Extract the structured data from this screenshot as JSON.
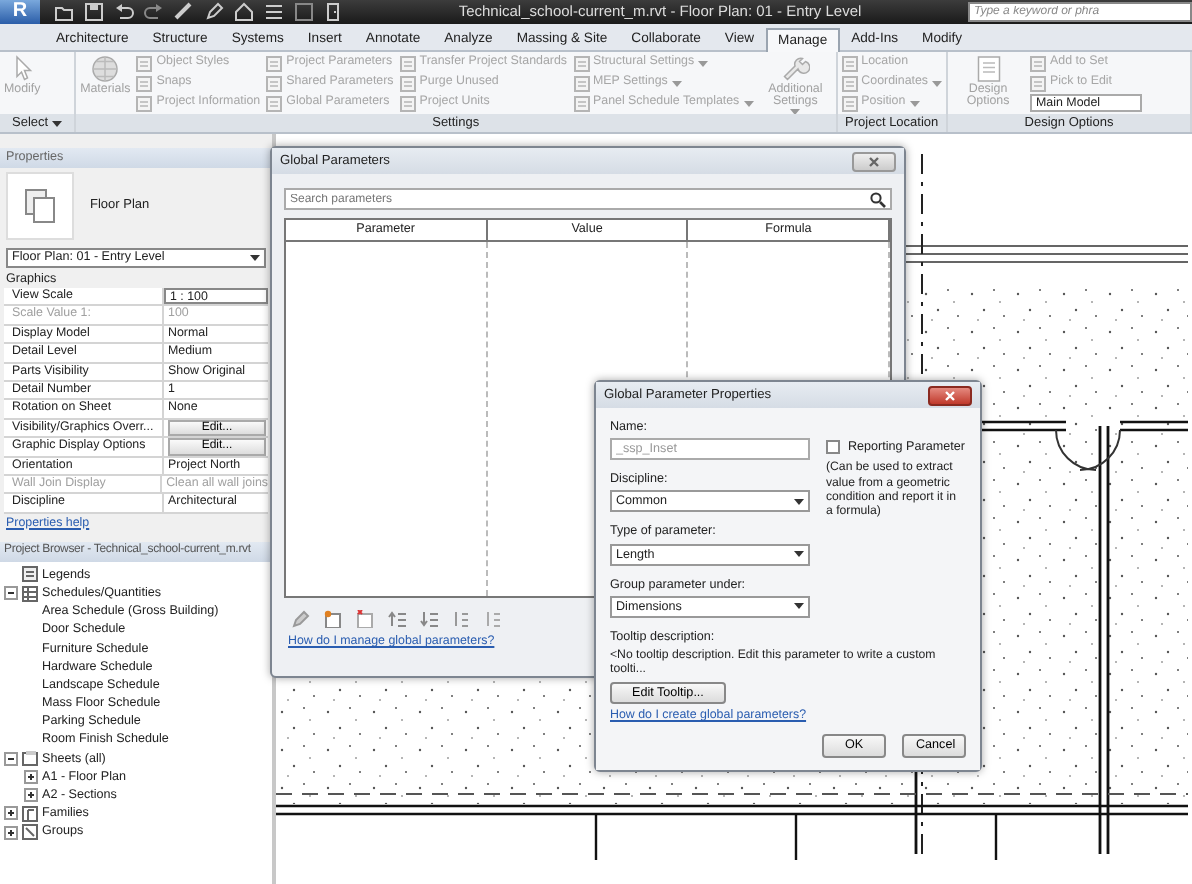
{
  "window": {
    "logo": "R",
    "title": "Technical_school-current_m.rvt - Floor Plan: 01 - Entry Level"
  },
  "help_search": {
    "placeholder": "Type a keyword or phra"
  },
  "ribbon_tabs": [
    {
      "label": "Architecture",
      "selected": false
    },
    {
      "label": "Structure",
      "selected": false
    },
    {
      "label": "Systems",
      "selected": false
    },
    {
      "label": "Insert",
      "selected": false
    },
    {
      "label": "Annotate",
      "selected": false
    },
    {
      "label": "Analyze",
      "selected": false
    },
    {
      "label": "Massing & Site",
      "selected": false
    },
    {
      "label": "Collaborate",
      "selected": false
    },
    {
      "label": "View",
      "selected": false
    },
    {
      "label": "Manage",
      "selected": true
    },
    {
      "label": "Add-Ins",
      "selected": false
    },
    {
      "label": "Modify",
      "selected": false
    }
  ],
  "ribbon_panels": [
    {
      "label": "Select",
      "menu": true,
      "groups": [
        {
          "kind": "large",
          "label": "Modify",
          "menu": false
        }
      ]
    },
    {
      "label": "Settings",
      "menu": false,
      "groups": [
        {
          "kind": "large",
          "label": "Materials",
          "menu": false
        },
        {
          "kind": "stack",
          "items": [
            {
              "kind": "button",
              "label": "Object Styles",
              "menu": false
            },
            {
              "kind": "button",
              "label": "Snaps",
              "menu": false
            },
            {
              "kind": "button",
              "label": "Project Information",
              "menu": false
            }
          ]
        },
        {
          "kind": "stack",
          "items": [
            {
              "kind": "button",
              "label": "Project Parameters",
              "menu": false
            },
            {
              "kind": "button",
              "label": "Shared Parameters",
              "menu": false
            },
            {
              "kind": "button",
              "label": "Global Parameters",
              "menu": false
            }
          ]
        },
        {
          "kind": "stack",
          "items": [
            {
              "kind": "button",
              "label": "Transfer Project Standards",
              "menu": false
            },
            {
              "kind": "button",
              "label": "Purge Unused",
              "menu": false
            },
            {
              "kind": "button",
              "label": "Project Units",
              "menu": false
            }
          ]
        },
        {
          "kind": "stack",
          "items": [
            {
              "kind": "button",
              "label": "Structural Settings",
              "menu": true
            },
            {
              "kind": "button",
              "label": "MEP Settings",
              "menu": true
            },
            {
              "kind": "button",
              "label": "Panel Schedule Templates",
              "menu": true
            }
          ]
        },
        {
          "kind": "large",
          "label": "Additional Settings",
          "menu": true
        }
      ]
    },
    {
      "label": "Project Location",
      "menu": false,
      "groups": [
        {
          "kind": "stack",
          "items": [
            {
              "kind": "button",
              "label": "Location",
              "menu": false
            },
            {
              "kind": "button",
              "label": "Coordinates",
              "menu": true
            },
            {
              "kind": "button",
              "label": "Position",
              "menu": true
            }
          ]
        }
      ]
    },
    {
      "label": "Design Options",
      "menu": false,
      "groups": [
        {
          "kind": "large",
          "label": "Design Options",
          "menu": false
        },
        {
          "kind": "stack",
          "items": [
            {
              "kind": "button",
              "label": "Add to Set",
              "menu": false
            },
            {
              "kind": "button",
              "label": "Pick to Edit",
              "menu": false
            },
            {
              "kind": "select",
              "label": "Main Model"
            }
          ]
        }
      ]
    }
  ],
  "properties": {
    "header": "Properties",
    "type_name": "Floor Plan",
    "view_selector": "Floor Plan: 01 - Entry Level",
    "group": "Graphics",
    "rows": [
      {
        "name": "View Scale",
        "value": "1 : 100",
        "kind": "field",
        "disabled": false
      },
      {
        "name": "Scale Value    1:",
        "value": "100",
        "kind": "text",
        "disabled": true
      },
      {
        "name": "Display Model",
        "value": "Normal",
        "kind": "text",
        "disabled": false
      },
      {
        "name": "Detail Level",
        "value": "Medium",
        "kind": "text",
        "disabled": false
      },
      {
        "name": "Parts Visibility",
        "value": "Show Original",
        "kind": "text",
        "disabled": false
      },
      {
        "name": "Detail Number",
        "value": "1",
        "kind": "text",
        "disabled": false
      },
      {
        "name": "Rotation on Sheet",
        "value": "None",
        "kind": "text",
        "disabled": false
      },
      {
        "name": "Visibility/Graphics Overr...",
        "value": "Edit...",
        "kind": "button",
        "disabled": false
      },
      {
        "name": "Graphic Display Options",
        "value": "Edit...",
        "kind": "button",
        "disabled": false
      },
      {
        "name": "Orientation",
        "value": "Project North",
        "kind": "text",
        "disabled": false
      },
      {
        "name": "Wall Join Display",
        "value": "Clean all wall joins",
        "kind": "text",
        "disabled": true
      },
      {
        "name": "Discipline",
        "value": "Architectural",
        "kind": "text",
        "disabled": false
      }
    ],
    "help_link": "Properties help"
  },
  "project_browser": {
    "header": "Project Browser - Technical_school-current_m.rvt",
    "tree": [
      {
        "label": "Legends"
      },
      {
        "label": "Schedules/Quantities",
        "expanded": true,
        "children": [
          {
            "label": "Area Schedule (Gross Building)"
          },
          {
            "label": "Door Schedule"
          },
          {
            "label": "Furniture Schedule"
          },
          {
            "label": "Hardware Schedule"
          },
          {
            "label": "Landscape Schedule"
          },
          {
            "label": "Mass Floor Schedule"
          },
          {
            "label": "Parking Schedule"
          },
          {
            "label": "Room Finish Schedule"
          }
        ]
      },
      {
        "label": "Sheets (all)",
        "expanded": true,
        "children": [
          {
            "label": "A1 - Floor Plan",
            "expanded": false
          },
          {
            "label": "A2 - Sections",
            "expanded": false
          }
        ]
      },
      {
        "label": "Families",
        "expanded": false
      },
      {
        "label": "Groups",
        "expanded": false
      }
    ]
  },
  "global_parameters": {
    "title": "Global Parameters",
    "search_placeholder": "Search parameters",
    "columns": [
      "Parameter",
      "Value",
      "Formula"
    ],
    "help_link": "How do I manage global parameters?"
  },
  "parameter_properties": {
    "title": "Global Parameter Properties",
    "name_label": "Name:",
    "name_value": "_ssp_Inset",
    "reporting": {
      "label": "Reporting Parameter",
      "checked": false
    },
    "reporting_note": "(Can be used to extract value from a geometric condition and report it in a formula)",
    "fields": [
      {
        "label": "Discipline:",
        "value": "Common"
      },
      {
        "label": "Type of parameter:",
        "value": "Length"
      },
      {
        "label": "Group parameter under:",
        "value": "Dimensions"
      }
    ],
    "tooltip_label": "Tooltip description:",
    "tooltip_text": "<No tooltip description. Edit this parameter to write a custom toolti...",
    "edit_tooltip": "Edit Tooltip...",
    "help_link": "How do I create global parameters?",
    "buttons": [
      "OK",
      "Cancel"
    ]
  }
}
